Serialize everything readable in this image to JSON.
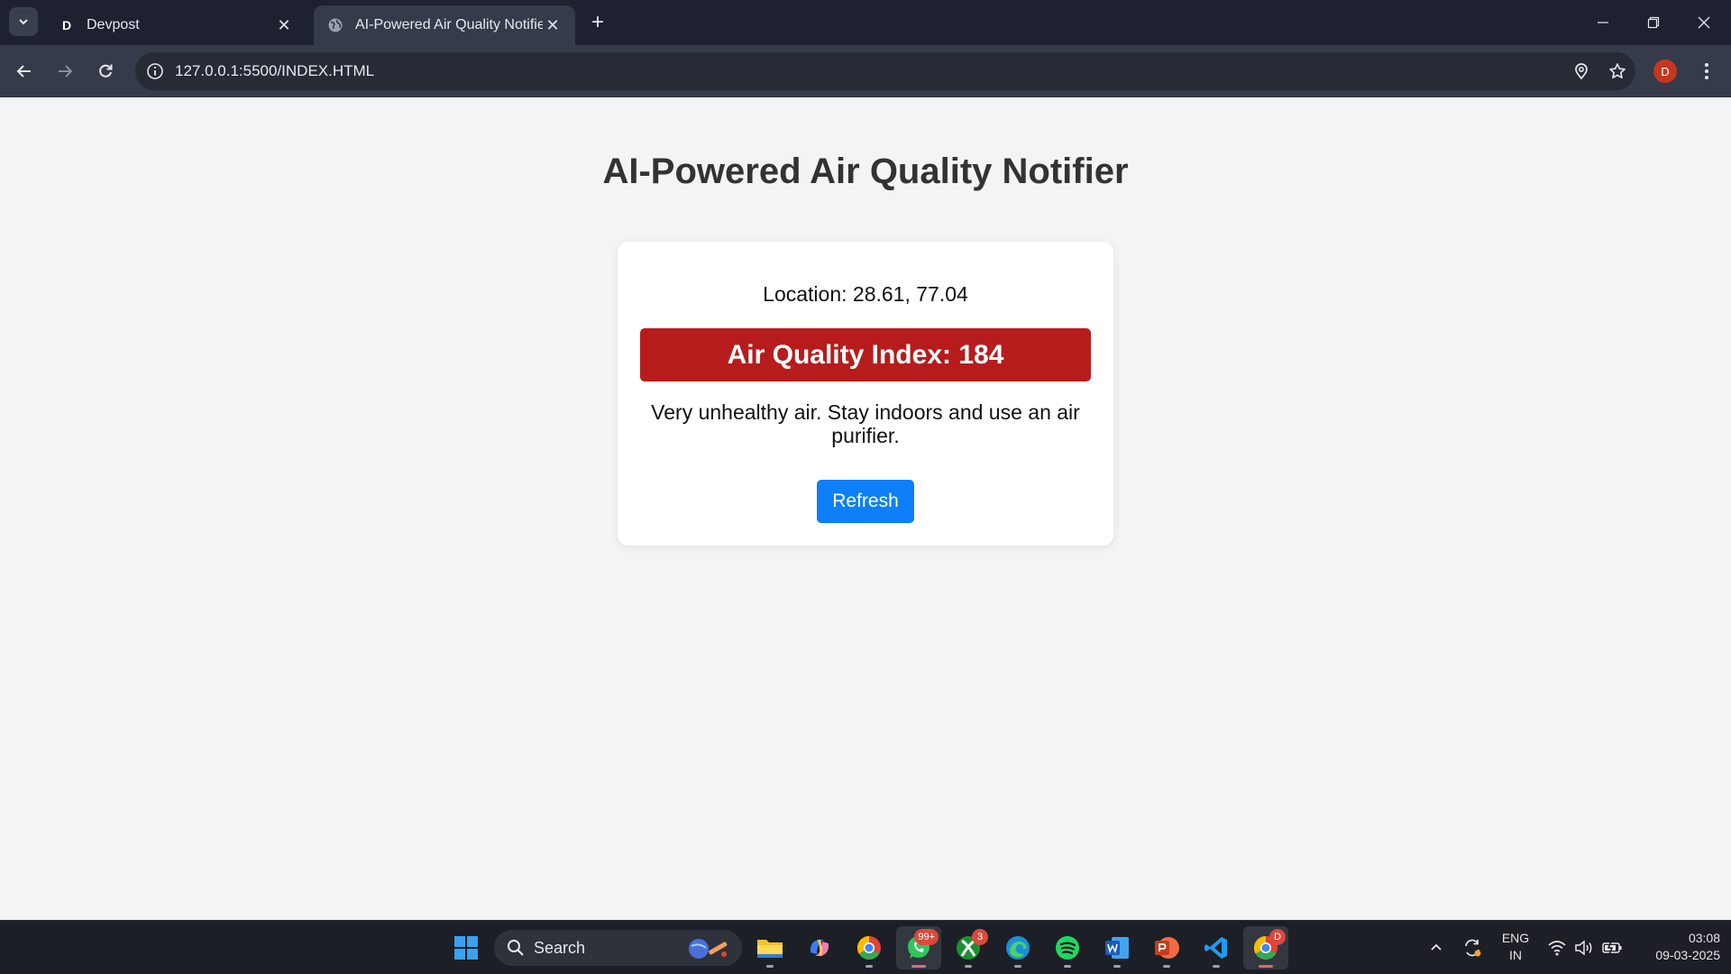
{
  "browser": {
    "tabs": [
      {
        "title": "Devpost",
        "favicon": "D"
      },
      {
        "title": "AI-Powered Air Quality Notifier"
      }
    ],
    "url": "127.0.0.1:5500/INDEX.HTML",
    "profile_initial": "D"
  },
  "page": {
    "heading": "AI-Powered Air Quality Notifier",
    "location": "Location: 28.61, 77.04",
    "aqi_label": "Air Quality Index: 184",
    "advice": "Very unhealthy air. Stay indoors and use an air purifier.",
    "refresh_label": "Refresh",
    "aqi_color": "#b71c1c",
    "button_color": "#0d7ff8"
  },
  "taskbar": {
    "search_placeholder": "Search",
    "whatsapp_badge": "99+",
    "xbox_badge": "3",
    "chrome_badge": "D",
    "language_line1": "ENG",
    "language_line2": "IN",
    "time": "03:08",
    "date": "09-03-2025"
  }
}
